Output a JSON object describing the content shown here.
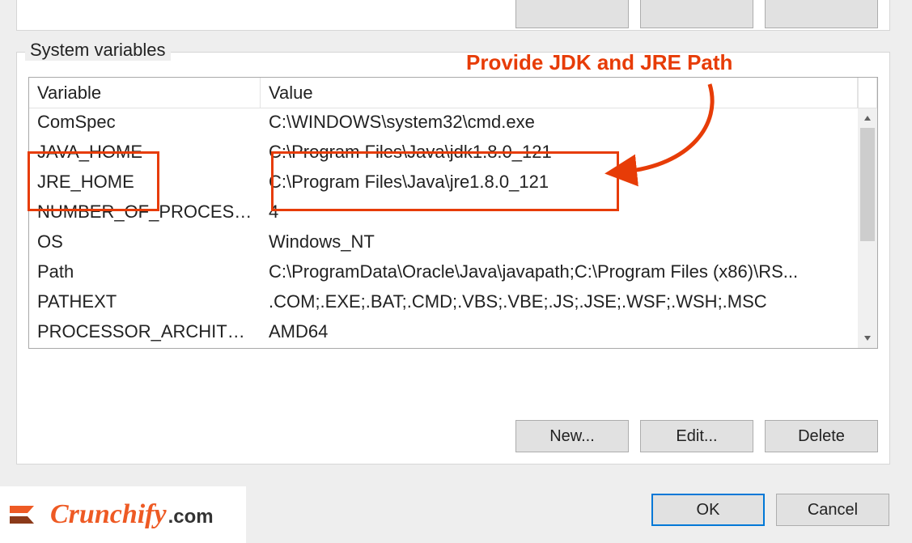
{
  "top_buttons": {
    "b1": "",
    "b2": "",
    "b3": ""
  },
  "sys_group": {
    "title": "System variables",
    "headers": {
      "variable": "Variable",
      "value": "Value"
    },
    "rows": [
      {
        "variable": "ComSpec",
        "value": "C:\\WINDOWS\\system32\\cmd.exe"
      },
      {
        "variable": "JAVA_HOME",
        "value": "C:\\Program Files\\Java\\jdk1.8.0_121"
      },
      {
        "variable": "JRE_HOME",
        "value": "C:\\Program Files\\Java\\jre1.8.0_121"
      },
      {
        "variable": "NUMBER_OF_PROCESSORS",
        "value": "4"
      },
      {
        "variable": "OS",
        "value": "Windows_NT"
      },
      {
        "variable": "Path",
        "value": "C:\\ProgramData\\Oracle\\Java\\javapath;C:\\Program Files (x86)\\RS..."
      },
      {
        "variable": "PATHEXT",
        "value": ".COM;.EXE;.BAT;.CMD;.VBS;.VBE;.JS;.JSE;.WSF;.WSH;.MSC"
      },
      {
        "variable": "PROCESSOR_ARCHITECTURE",
        "value": "AMD64"
      }
    ],
    "buttons": {
      "new": "New...",
      "edit": "Edit...",
      "delete": "Delete"
    }
  },
  "dialog_buttons": {
    "ok": "OK",
    "cancel": "Cancel"
  },
  "annotation": {
    "label": "Provide JDK and JRE Path",
    "color": "#e73c07"
  },
  "logo": {
    "word": "Crunchify",
    "tld": ".com"
  }
}
